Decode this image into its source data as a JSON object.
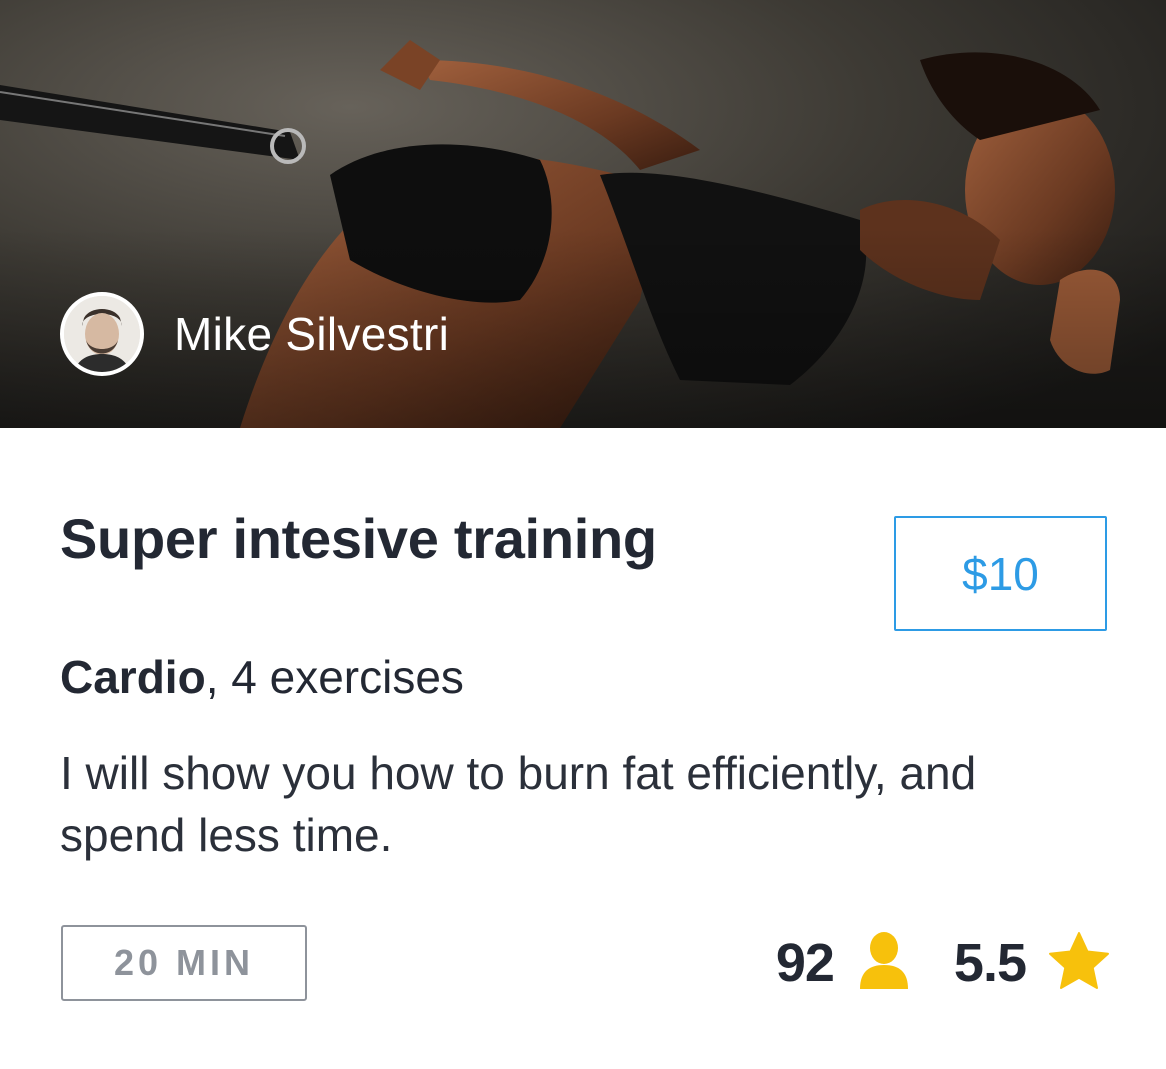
{
  "hero": {
    "author": {
      "name": "Mike Silvestri"
    }
  },
  "course": {
    "title": "Super intesive training",
    "price": "$10",
    "category": "Cardio",
    "category_suffix": ", 4 exercises",
    "description": "I will show you how to burn fat efficiently, and spend less time.",
    "duration": "20 MIN"
  },
  "stats": {
    "participants": "92",
    "participants_icon": "user-icon",
    "rating": "5.5",
    "rating_icon": "star-icon"
  },
  "colors": {
    "accent": "#2d9be5",
    "text": "#232833",
    "muted": "#8e939b",
    "icon_gold": "#f7c10c"
  }
}
